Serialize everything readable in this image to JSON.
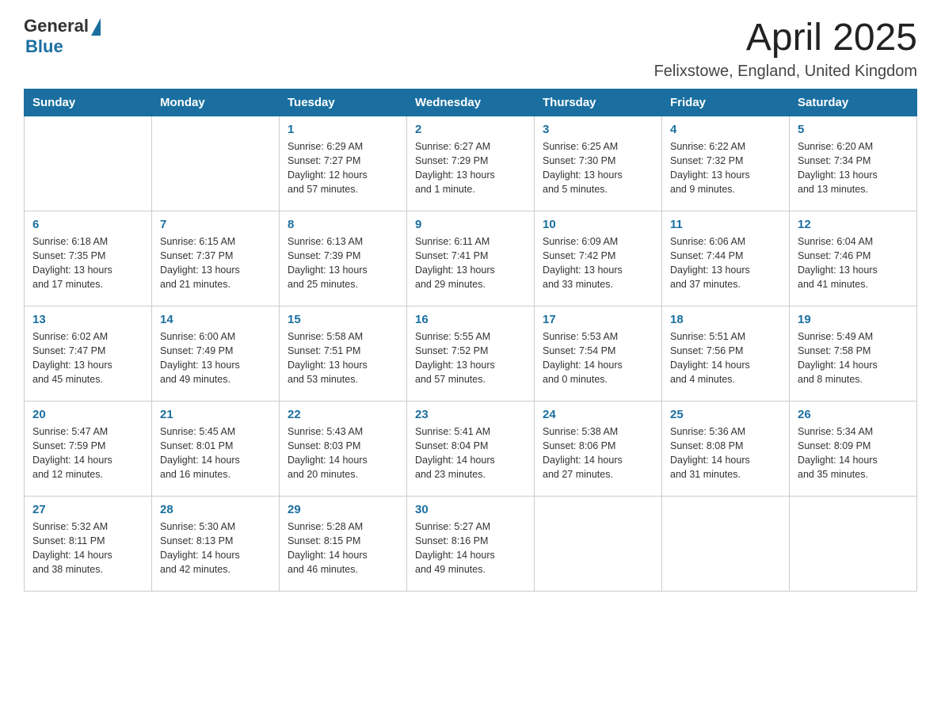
{
  "header": {
    "logo_general": "General",
    "logo_blue": "Blue",
    "main_title": "April 2025",
    "subtitle": "Felixstowe, England, United Kingdom"
  },
  "calendar": {
    "days_of_week": [
      "Sunday",
      "Monday",
      "Tuesday",
      "Wednesday",
      "Thursday",
      "Friday",
      "Saturday"
    ],
    "weeks": [
      [
        {
          "day": "",
          "info": []
        },
        {
          "day": "",
          "info": []
        },
        {
          "day": "1",
          "info": [
            "Sunrise: 6:29 AM",
            "Sunset: 7:27 PM",
            "Daylight: 12 hours",
            "and 57 minutes."
          ]
        },
        {
          "day": "2",
          "info": [
            "Sunrise: 6:27 AM",
            "Sunset: 7:29 PM",
            "Daylight: 13 hours",
            "and 1 minute."
          ]
        },
        {
          "day": "3",
          "info": [
            "Sunrise: 6:25 AM",
            "Sunset: 7:30 PM",
            "Daylight: 13 hours",
            "and 5 minutes."
          ]
        },
        {
          "day": "4",
          "info": [
            "Sunrise: 6:22 AM",
            "Sunset: 7:32 PM",
            "Daylight: 13 hours",
            "and 9 minutes."
          ]
        },
        {
          "day": "5",
          "info": [
            "Sunrise: 6:20 AM",
            "Sunset: 7:34 PM",
            "Daylight: 13 hours",
            "and 13 minutes."
          ]
        }
      ],
      [
        {
          "day": "6",
          "info": [
            "Sunrise: 6:18 AM",
            "Sunset: 7:35 PM",
            "Daylight: 13 hours",
            "and 17 minutes."
          ]
        },
        {
          "day": "7",
          "info": [
            "Sunrise: 6:15 AM",
            "Sunset: 7:37 PM",
            "Daylight: 13 hours",
            "and 21 minutes."
          ]
        },
        {
          "day": "8",
          "info": [
            "Sunrise: 6:13 AM",
            "Sunset: 7:39 PM",
            "Daylight: 13 hours",
            "and 25 minutes."
          ]
        },
        {
          "day": "9",
          "info": [
            "Sunrise: 6:11 AM",
            "Sunset: 7:41 PM",
            "Daylight: 13 hours",
            "and 29 minutes."
          ]
        },
        {
          "day": "10",
          "info": [
            "Sunrise: 6:09 AM",
            "Sunset: 7:42 PM",
            "Daylight: 13 hours",
            "and 33 minutes."
          ]
        },
        {
          "day": "11",
          "info": [
            "Sunrise: 6:06 AM",
            "Sunset: 7:44 PM",
            "Daylight: 13 hours",
            "and 37 minutes."
          ]
        },
        {
          "day": "12",
          "info": [
            "Sunrise: 6:04 AM",
            "Sunset: 7:46 PM",
            "Daylight: 13 hours",
            "and 41 minutes."
          ]
        }
      ],
      [
        {
          "day": "13",
          "info": [
            "Sunrise: 6:02 AM",
            "Sunset: 7:47 PM",
            "Daylight: 13 hours",
            "and 45 minutes."
          ]
        },
        {
          "day": "14",
          "info": [
            "Sunrise: 6:00 AM",
            "Sunset: 7:49 PM",
            "Daylight: 13 hours",
            "and 49 minutes."
          ]
        },
        {
          "day": "15",
          "info": [
            "Sunrise: 5:58 AM",
            "Sunset: 7:51 PM",
            "Daylight: 13 hours",
            "and 53 minutes."
          ]
        },
        {
          "day": "16",
          "info": [
            "Sunrise: 5:55 AM",
            "Sunset: 7:52 PM",
            "Daylight: 13 hours",
            "and 57 minutes."
          ]
        },
        {
          "day": "17",
          "info": [
            "Sunrise: 5:53 AM",
            "Sunset: 7:54 PM",
            "Daylight: 14 hours",
            "and 0 minutes."
          ]
        },
        {
          "day": "18",
          "info": [
            "Sunrise: 5:51 AM",
            "Sunset: 7:56 PM",
            "Daylight: 14 hours",
            "and 4 minutes."
          ]
        },
        {
          "day": "19",
          "info": [
            "Sunrise: 5:49 AM",
            "Sunset: 7:58 PM",
            "Daylight: 14 hours",
            "and 8 minutes."
          ]
        }
      ],
      [
        {
          "day": "20",
          "info": [
            "Sunrise: 5:47 AM",
            "Sunset: 7:59 PM",
            "Daylight: 14 hours",
            "and 12 minutes."
          ]
        },
        {
          "day": "21",
          "info": [
            "Sunrise: 5:45 AM",
            "Sunset: 8:01 PM",
            "Daylight: 14 hours",
            "and 16 minutes."
          ]
        },
        {
          "day": "22",
          "info": [
            "Sunrise: 5:43 AM",
            "Sunset: 8:03 PM",
            "Daylight: 14 hours",
            "and 20 minutes."
          ]
        },
        {
          "day": "23",
          "info": [
            "Sunrise: 5:41 AM",
            "Sunset: 8:04 PM",
            "Daylight: 14 hours",
            "and 23 minutes."
          ]
        },
        {
          "day": "24",
          "info": [
            "Sunrise: 5:38 AM",
            "Sunset: 8:06 PM",
            "Daylight: 14 hours",
            "and 27 minutes."
          ]
        },
        {
          "day": "25",
          "info": [
            "Sunrise: 5:36 AM",
            "Sunset: 8:08 PM",
            "Daylight: 14 hours",
            "and 31 minutes."
          ]
        },
        {
          "day": "26",
          "info": [
            "Sunrise: 5:34 AM",
            "Sunset: 8:09 PM",
            "Daylight: 14 hours",
            "and 35 minutes."
          ]
        }
      ],
      [
        {
          "day": "27",
          "info": [
            "Sunrise: 5:32 AM",
            "Sunset: 8:11 PM",
            "Daylight: 14 hours",
            "and 38 minutes."
          ]
        },
        {
          "day": "28",
          "info": [
            "Sunrise: 5:30 AM",
            "Sunset: 8:13 PM",
            "Daylight: 14 hours",
            "and 42 minutes."
          ]
        },
        {
          "day": "29",
          "info": [
            "Sunrise: 5:28 AM",
            "Sunset: 8:15 PM",
            "Daylight: 14 hours",
            "and 46 minutes."
          ]
        },
        {
          "day": "30",
          "info": [
            "Sunrise: 5:27 AM",
            "Sunset: 8:16 PM",
            "Daylight: 14 hours",
            "and 49 minutes."
          ]
        },
        {
          "day": "",
          "info": []
        },
        {
          "day": "",
          "info": []
        },
        {
          "day": "",
          "info": []
        }
      ]
    ]
  }
}
